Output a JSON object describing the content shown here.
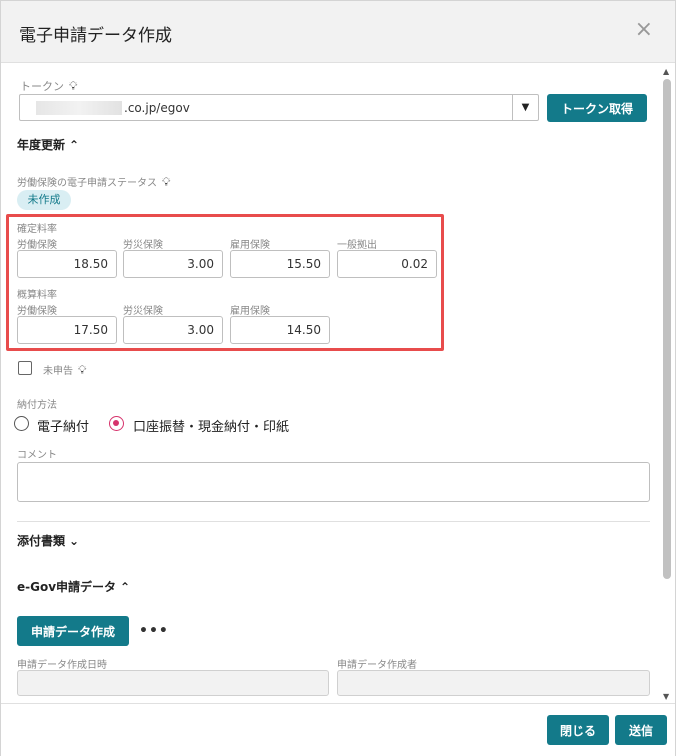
{
  "dialog": {
    "title": "電子申請データ作成",
    "close_glyph": "×"
  },
  "token": {
    "label": "トークン",
    "value": ".co.jp/egov",
    "button": "トークン取得"
  },
  "annual_update": {
    "title": "年度更新",
    "status_label": "労働保険の電子申請ステータス",
    "status_badge": "未作成",
    "confirmed_rates": {
      "label": "確定料率",
      "fields": [
        {
          "label": "労働保険",
          "value": "18.50"
        },
        {
          "label": "労災保険",
          "value": "3.00"
        },
        {
          "label": "雇用保険",
          "value": "15.50"
        },
        {
          "label": "一般拠出",
          "value": "0.02"
        }
      ]
    },
    "estimated_rates": {
      "label": "概算料率",
      "fields": [
        {
          "label": "労働保険",
          "value": "17.50"
        },
        {
          "label": "労災保険",
          "value": "3.00"
        },
        {
          "label": "雇用保険",
          "value": "14.50"
        }
      ]
    },
    "unfiled_label": "未申告",
    "payment_label": "納付方法",
    "payment_options": [
      {
        "label": "電子納付",
        "selected": false
      },
      {
        "label": "口座振替・現金納付・印紙",
        "selected": true
      }
    ],
    "comment_label": "コメント"
  },
  "attachments": {
    "title": "添付書類"
  },
  "egov": {
    "title": "e-Gov申請データ",
    "create_button": "申請データ作成",
    "more_glyph": "•••",
    "created_at_label": "申請データ作成日時",
    "created_by_label": "申請データ作成者"
  },
  "footer": {
    "close_button": "閉じる",
    "send_button": "送信"
  },
  "colors": {
    "accent": "#137a8a",
    "highlight": "#e84c4c",
    "radio_selected": "#d6336c"
  }
}
